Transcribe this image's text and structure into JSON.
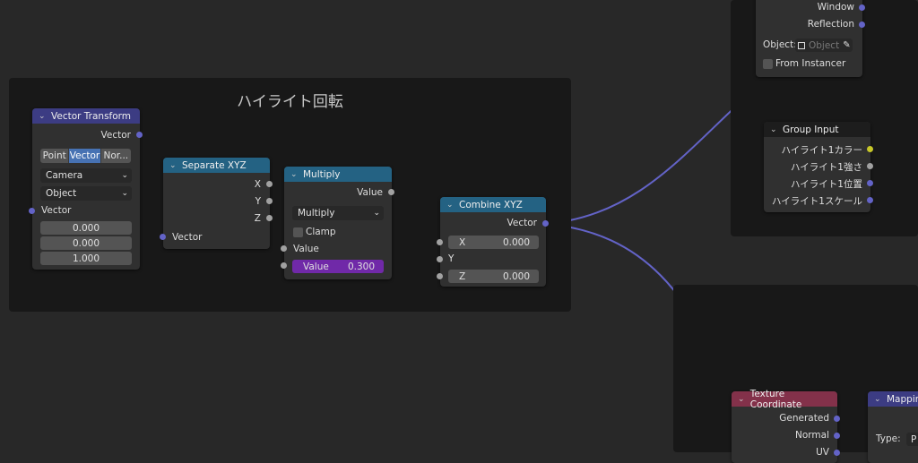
{
  "frame": {
    "title": "ハイライト回転"
  },
  "vector_transform": {
    "title": "Vector Transform",
    "output_vector": "Vector",
    "modes": [
      "Point",
      "Vector",
      "Nor..."
    ],
    "active_mode": "Vector",
    "convert_from": "Camera",
    "convert_to": "Object",
    "input_vector": "Vector",
    "values": [
      "0.000",
      "0.000",
      "1.000"
    ]
  },
  "separate_xyz": {
    "title": "Separate XYZ",
    "outputs": [
      "X",
      "Y",
      "Z"
    ],
    "input": "Vector"
  },
  "multiply": {
    "title": "Multiply",
    "output": "Value",
    "operation": "Multiply",
    "clamp_label": "Clamp",
    "input_value": "Value",
    "value_label": "Value",
    "value": "0.300"
  },
  "combine_xyz": {
    "title": "Combine XYZ",
    "output": "Vector",
    "x_label": "X",
    "x_value": "0.000",
    "y_label": "Y",
    "z_label": "Z",
    "z_value": "0.000"
  },
  "texture_coord_top": {
    "window": "Window",
    "reflection": "Reflection",
    "object_label": "Object:",
    "object_placeholder": "Object",
    "from_instancer": "From Instancer"
  },
  "group_input": {
    "title": "Group Input",
    "outputs": [
      "ハイライト1カラー",
      "ハイライト1強さ",
      "ハイライト1位置",
      "ハイライト1スケール"
    ]
  },
  "texture_coordinate": {
    "title": "Texture Coordinate",
    "outputs": [
      "Generated",
      "Normal",
      "UV"
    ]
  },
  "mapping": {
    "title": "Mapping",
    "type_label": "Type:",
    "type_value": "P"
  },
  "colors": {
    "socket_vector": "#6363c7",
    "socket_float": "#a1a1a1",
    "socket_color": "#c7c729",
    "wire": "#6363c7"
  },
  "icons": [
    "chevron-down-icon",
    "eyedropper-icon",
    "object-icon"
  ]
}
